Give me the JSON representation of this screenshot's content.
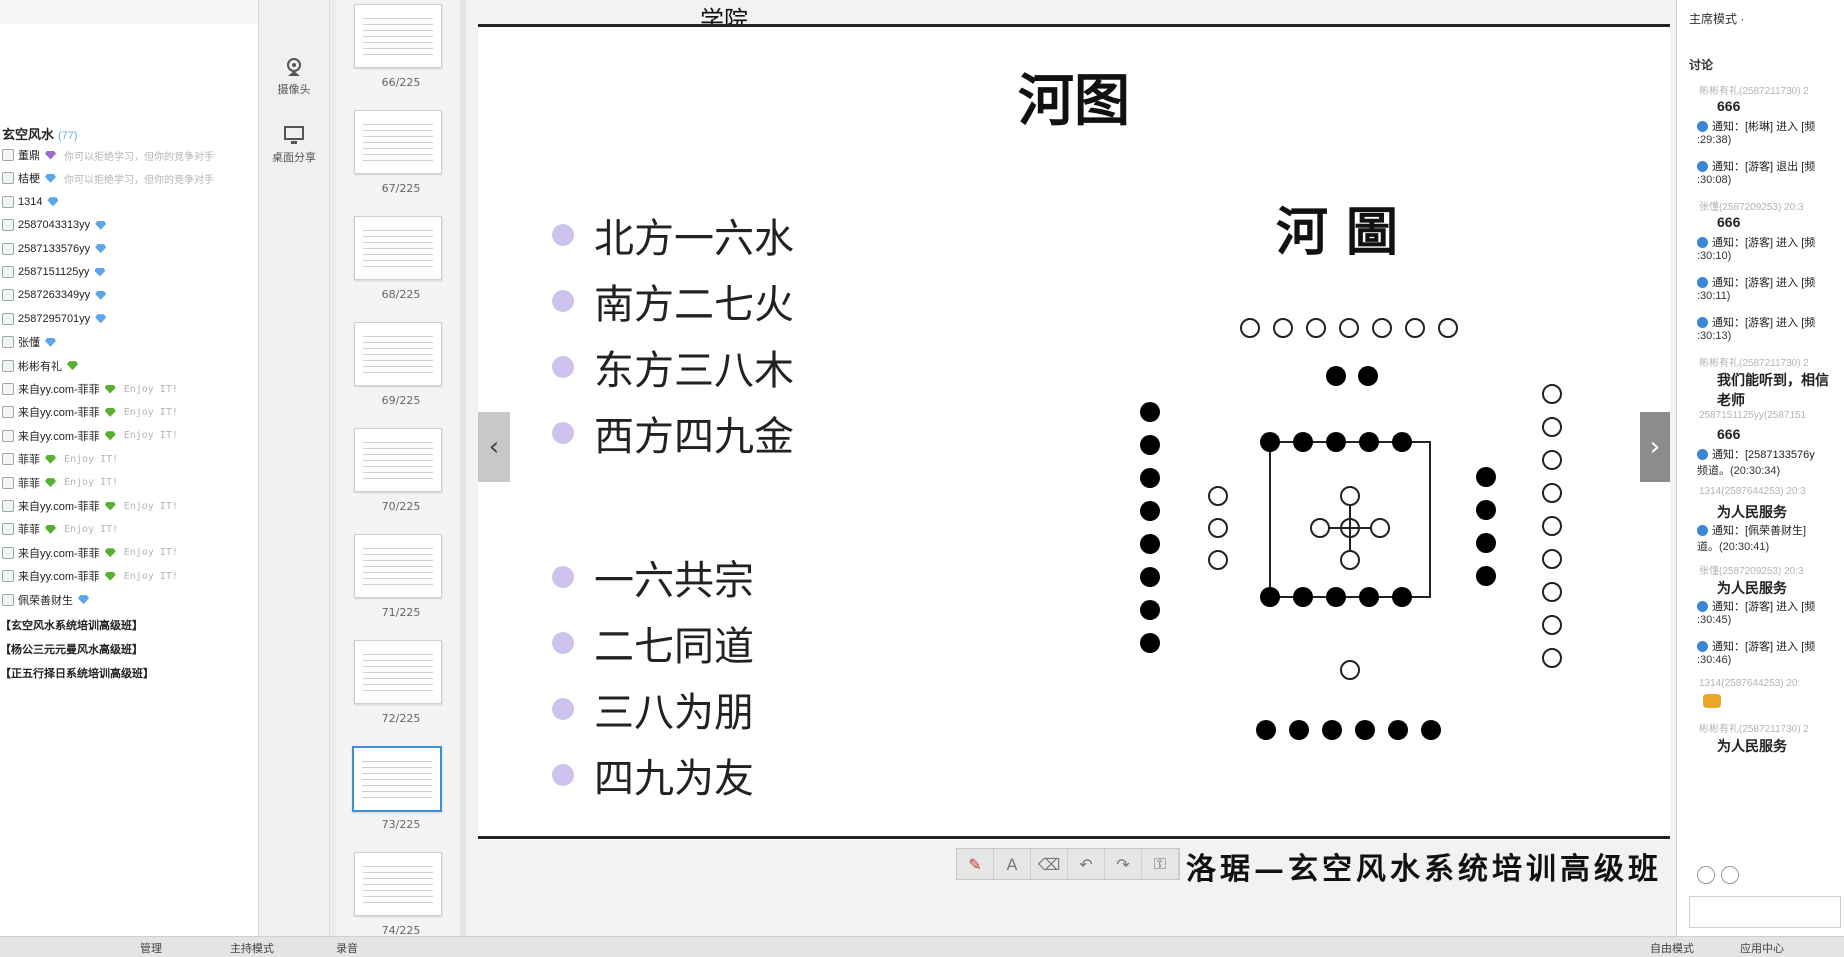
{
  "left_panel": {
    "channel": {
      "name": "玄空风水",
      "count": "(77)"
    },
    "members": [
      {
        "name": "董鼎",
        "badge": "purple",
        "sig": "你可以拒绝学习，但你的竞争对手"
      },
      {
        "name": "桔梗",
        "badge": "blue",
        "sig": "你可以拒绝学习，但你的竞争对手"
      },
      {
        "name": "1314",
        "badge": "blue",
        "sig": ""
      },
      {
        "name": "2587043313yy",
        "badge": "blue",
        "sig": ""
      },
      {
        "name": "2587133576yy",
        "badge": "blue",
        "sig": ""
      },
      {
        "name": "2587151125yy",
        "badge": "blue",
        "sig": ""
      },
      {
        "name": "2587263349yy",
        "badge": "blue",
        "sig": ""
      },
      {
        "name": "2587295701yy",
        "badge": "blue",
        "sig": ""
      },
      {
        "name": "张懂",
        "badge": "blue",
        "sig": ""
      },
      {
        "name": "彬彬有礼",
        "badge": "green",
        "sig": ""
      },
      {
        "name": "来自yy.com-菲菲",
        "badge": "green",
        "sig": "Enjoy IT!"
      },
      {
        "name": "来自yy.com-菲菲",
        "badge": "green",
        "sig": "Enjoy IT!"
      },
      {
        "name": "来自yy.com-菲菲",
        "badge": "green",
        "sig": "Enjoy IT!"
      },
      {
        "name": "菲菲",
        "badge": "green",
        "sig": "Enjoy IT!"
      },
      {
        "name": "菲菲",
        "badge": "green",
        "sig": "Enjoy IT!"
      },
      {
        "name": "来自yy.com-菲菲",
        "badge": "green",
        "sig": "Enjoy IT!"
      },
      {
        "name": "菲菲",
        "badge": "green",
        "sig": "Enjoy IT!"
      },
      {
        "name": "来自yy.com-菲菲",
        "badge": "green",
        "sig": "Enjoy IT!"
      },
      {
        "name": "来自yy.com-菲菲",
        "badge": "green",
        "sig": "Enjoy IT!"
      },
      {
        "name": "佩荣善财生",
        "badge": "blue",
        "sig": ""
      }
    ],
    "sub_channels": [
      "【玄空风水系统培训高级班】",
      "【杨公三元元曼风水高级班】",
      "【正五行择日系统培训高级班】"
    ]
  },
  "tools": {
    "camera": "摄像头",
    "screen_share": "桌面分享"
  },
  "thumbnails": [
    {
      "label": "66/225",
      "selected": false
    },
    {
      "label": "67/225",
      "selected": false
    },
    {
      "label": "68/225",
      "selected": false
    },
    {
      "label": "69/225",
      "selected": false
    },
    {
      "label": "70/225",
      "selected": false
    },
    {
      "label": "71/225",
      "selected": false
    },
    {
      "label": "72/225",
      "selected": false
    },
    {
      "label": "73/225",
      "selected": true
    },
    {
      "label": "74/225",
      "selected": false
    }
  ],
  "slide": {
    "header_fragment": "学院",
    "title": "河图",
    "bullets_top": [
      "北方一六水",
      "南方二七火",
      "东方三八木",
      "西方四九金"
    ],
    "bullets_bottom": [
      "一六共宗",
      "二七同道",
      "三八为朋",
      "四九为友"
    ],
    "diagram_title": "河圖",
    "footer": "洛琚—玄空风水系统培训高级班"
  },
  "annot_tools": [
    "pen-icon",
    "text-icon",
    "eraser-icon",
    "undo-icon",
    "redo-icon",
    "lock-icon"
  ],
  "chat": {
    "mode": "主席模式 ·",
    "header": "讨论",
    "items": [
      {
        "type": "sender",
        "text": "彬彬有礼(2587211730) 2"
      },
      {
        "type": "body",
        "text": "666"
      },
      {
        "type": "notice",
        "text": "通知：[彬琳] 进入 [频"
      },
      {
        "type": "time",
        "text": ":29:38)"
      },
      {
        "type": "notice",
        "text": "通知：[游客] 退出 [频"
      },
      {
        "type": "time",
        "text": ":30:08)"
      },
      {
        "type": "sender",
        "text": "张懂(2587209253) 20:3"
      },
      {
        "type": "body",
        "text": "666"
      },
      {
        "type": "notice",
        "text": "通知：[游客] 进入 [频"
      },
      {
        "type": "time",
        "text": ":30:10)"
      },
      {
        "type": "notice",
        "text": "通知：[游客] 进入 [频"
      },
      {
        "type": "time",
        "text": ":30:11)"
      },
      {
        "type": "notice",
        "text": "通知：[游客] 进入 [频"
      },
      {
        "type": "time",
        "text": ":30:13)"
      },
      {
        "type": "sender",
        "text": "彬彬有礼(2587211730) 2"
      },
      {
        "type": "body",
        "text": "我们能听到，相信"
      },
      {
        "type": "body",
        "text": "老师"
      },
      {
        "type": "sender",
        "text": "2587151125yy(2587151"
      },
      {
        "type": "body",
        "text": "666"
      },
      {
        "type": "notice",
        "text": "通知：[2587133576y"
      },
      {
        "type": "time",
        "text": "频道。(20:30:34)"
      },
      {
        "type": "sender",
        "text": "1314(2587644253) 20:3"
      },
      {
        "type": "body",
        "text": "为人民服务"
      },
      {
        "type": "notice",
        "text": "通知：[佩荣善财生]"
      },
      {
        "type": "time",
        "text": "道。(20:30:41)"
      },
      {
        "type": "sender",
        "text": "张懂(2587209253) 20:3"
      },
      {
        "type": "body",
        "text": "为人民服务"
      },
      {
        "type": "notice",
        "text": "通知：[游客] 进入 [频"
      },
      {
        "type": "time",
        "text": ":30:45)"
      },
      {
        "type": "notice",
        "text": "通知：[游客] 进入 [频"
      },
      {
        "type": "time",
        "text": ":30:46)"
      },
      {
        "type": "sender",
        "text": "1314(2587644253) 20:"
      },
      {
        "type": "emoji",
        "text": ""
      },
      {
        "type": "sender",
        "text": "彬彬有礼(2587211730) 2"
      },
      {
        "type": "body",
        "text": "为人民服务"
      }
    ]
  },
  "status": {
    "left_a": "管理",
    "left_b": "主持模式",
    "left_c": "录音",
    "right_a": "自由模式",
    "right_b": "应用中心"
  }
}
